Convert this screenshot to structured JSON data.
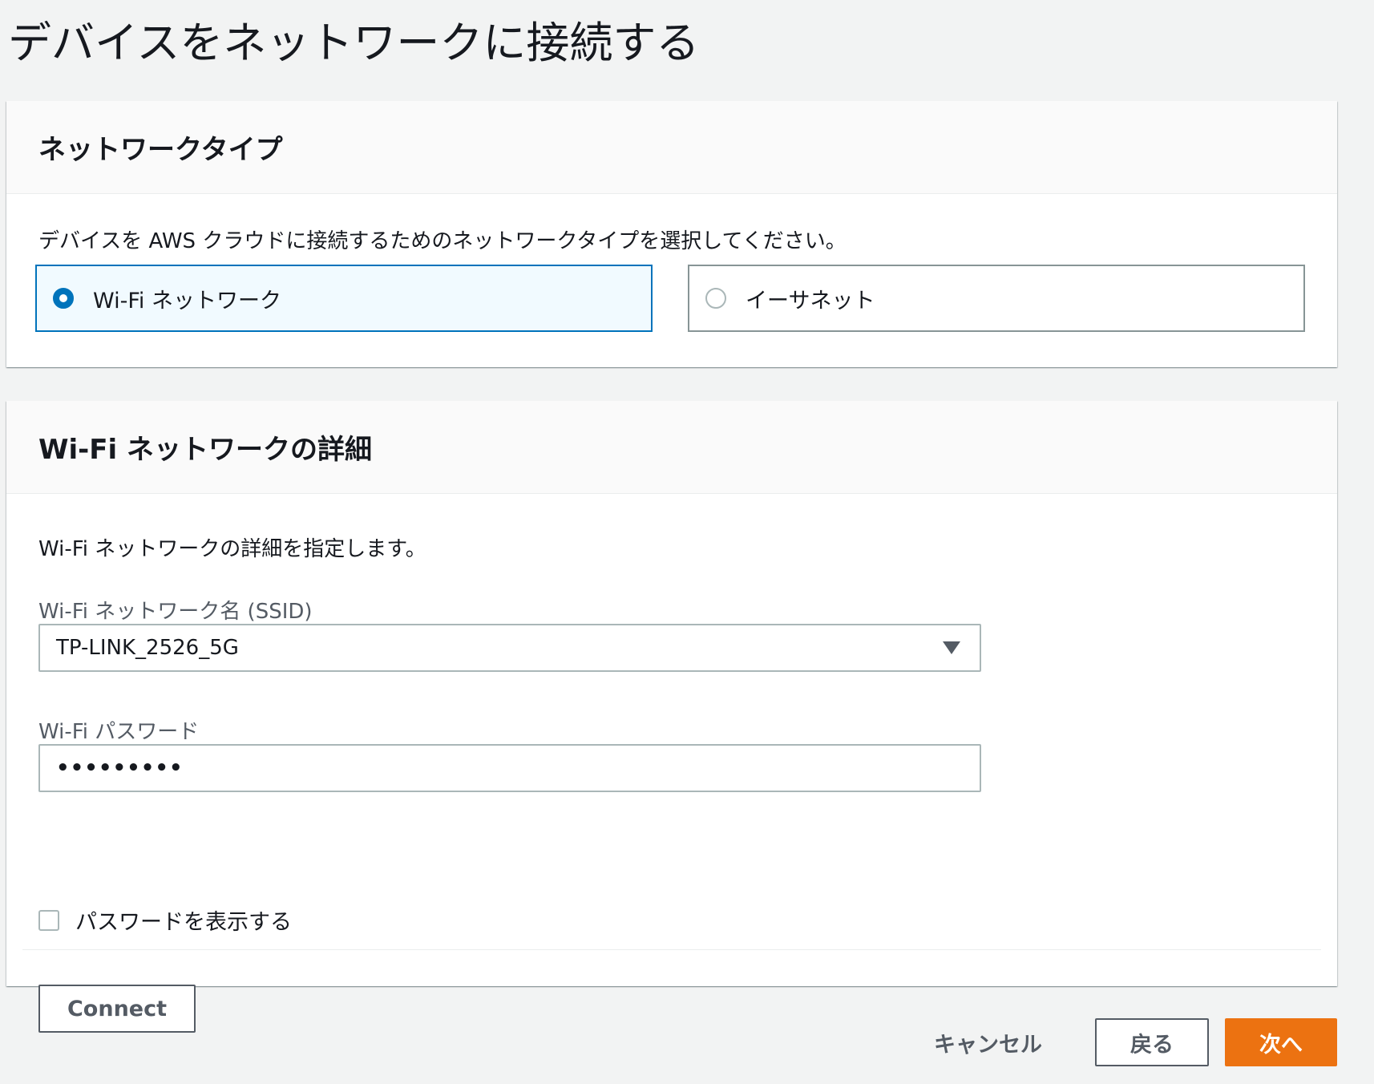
{
  "page": {
    "title": "デバイスをネットワークに接続する"
  },
  "network_type": {
    "heading": "ネットワークタイプ",
    "description": "デバイスを AWS クラウドに接続するためのネットワークタイプを選択してください。",
    "options": [
      {
        "label": "Wi-Fi ネットワーク",
        "selected": true
      },
      {
        "label": "イーサネット",
        "selected": false
      }
    ]
  },
  "wifi_details": {
    "heading": "Wi-Fi ネットワークの詳細",
    "description": "Wi-Fi ネットワークの詳細を指定します。",
    "ssid_label": "Wi-Fi ネットワーク名 (SSID)",
    "ssid_value": "TP-LINK_2526_5G",
    "password_label": "Wi-Fi パスワード",
    "password_masked": "•••••••••",
    "show_password_label": "パスワードを表示する",
    "show_password_checked": false,
    "connect_label": "Connect"
  },
  "footer": {
    "cancel_label": "キャンセル",
    "back_label": "戻る",
    "next_label": "次へ"
  },
  "colors": {
    "background": "#f2f3f3",
    "selected_border": "#0073bb",
    "selected_fill": "#f1faff",
    "primary_button": "#ec7211"
  }
}
